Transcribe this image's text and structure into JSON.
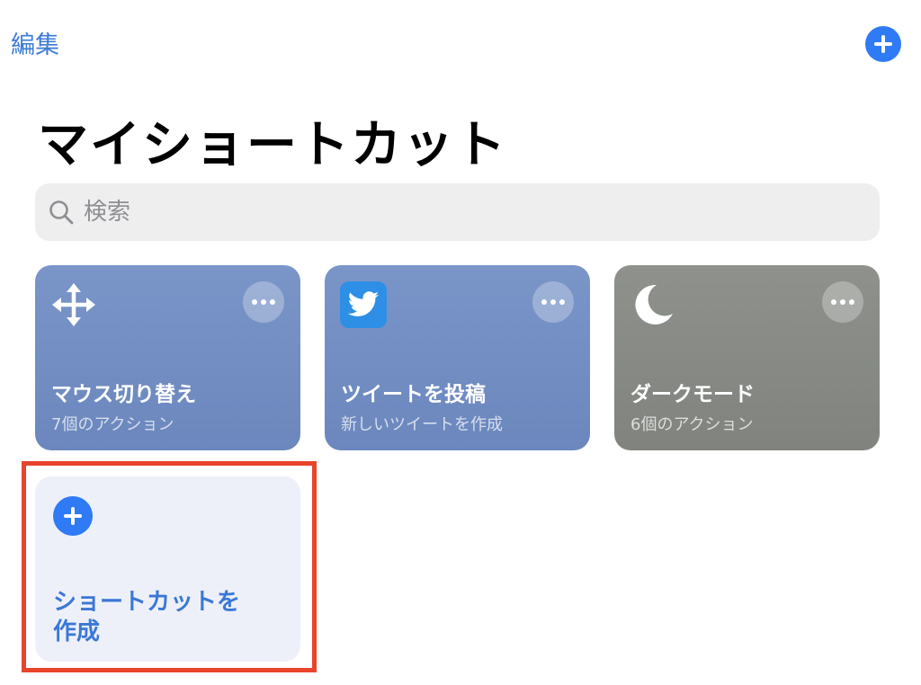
{
  "header": {
    "edit_label": "編集",
    "add_icon": "plus-circle-icon"
  },
  "title": "マイショートカット",
  "search": {
    "placeholder": "検索",
    "value": "",
    "icon": "search-icon"
  },
  "shortcuts": [
    {
      "icon": "move-arrows-icon",
      "title": "マウス切り替え",
      "subtitle": "7個のアクション",
      "color": "#7590c4"
    },
    {
      "icon": "twitter-icon",
      "title": "ツイートを投稿",
      "subtitle": "新しいツイートを作成",
      "color": "#7590c4"
    },
    {
      "icon": "moon-icon",
      "title": "ダークモード",
      "subtitle": "6個のアクション",
      "color": "#898c87"
    }
  ],
  "create": {
    "icon": "plus-circle-icon",
    "label": "ショートカットを作成"
  },
  "colors": {
    "accent": "#2f7bf5",
    "highlight": "#e8432b"
  }
}
